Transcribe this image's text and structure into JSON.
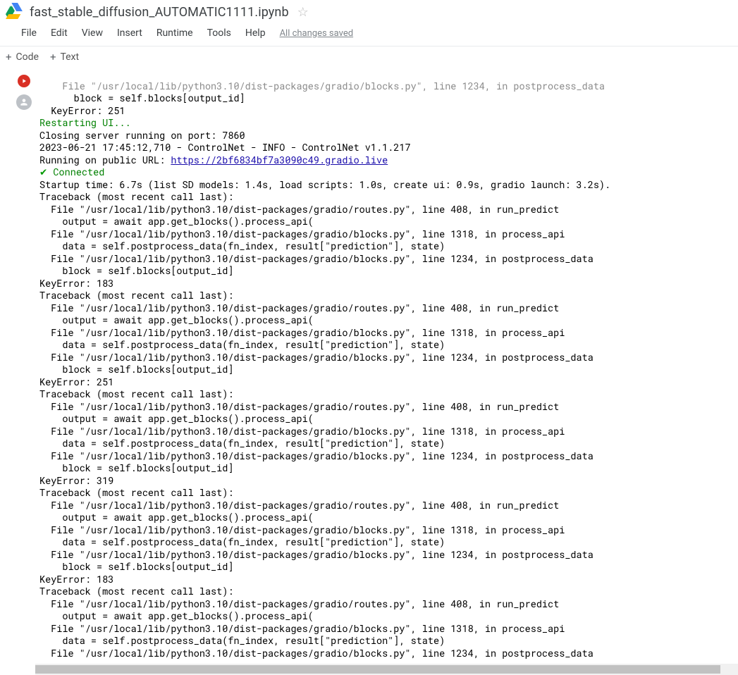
{
  "header": {
    "title": "fast_stable_diffusion_AUTOMATIC1111.ipynb"
  },
  "menu": {
    "file": "File",
    "edit": "Edit",
    "view": "View",
    "insert": "Insert",
    "runtime": "Runtime",
    "tools": "Tools",
    "help": "Help",
    "status": "All changes saved"
  },
  "toolbar": {
    "code": "Code",
    "text": "Text"
  },
  "output": {
    "cut_line": "    File \"/usr/local/lib/python3.10/dist-packages/gradio/blocks.py\", line 1234, in postprocess_data",
    "cut_block": "      block = self.blocks[output_id]",
    "cut_err": "  KeyError: 251",
    "restart": "Restarting UI...",
    "closing": "Closing server running on port: 7860",
    "cnet": "2023-06-21 17:45:12,710 - ControlNet - INFO - ControlNet v1.1.217",
    "running_prefix": "Running on public URL: ",
    "url": "https://2bf6834bf7a3090c49.gradio.live",
    "check": "✔",
    "connected": " Connected",
    "startup": "Startup time: 6.7s (list SD models: 1.4s, load scripts: 1.0s, create ui: 0.9s, gradio launch: 3.2s).",
    "tb_header": "Traceback (most recent call last):",
    "tb_l1": "  File \"/usr/local/lib/python3.10/dist-packages/gradio/routes.py\", line 408, in run_predict",
    "tb_l2": "    output = await app.get_blocks().process_api(",
    "tb_l3": "  File \"/usr/local/lib/python3.10/dist-packages/gradio/blocks.py\", line 1318, in process_api",
    "tb_l4": "    data = self.postprocess_data(fn_index, result[\"prediction\"], state)",
    "tb_l5": "  File \"/usr/local/lib/python3.10/dist-packages/gradio/blocks.py\", line 1234, in postprocess_data",
    "tb_l6": "    block = self.blocks[output_id]",
    "ke183": "KeyError: 183",
    "ke251": "KeyError: 251",
    "ke319": "KeyError: 319"
  }
}
